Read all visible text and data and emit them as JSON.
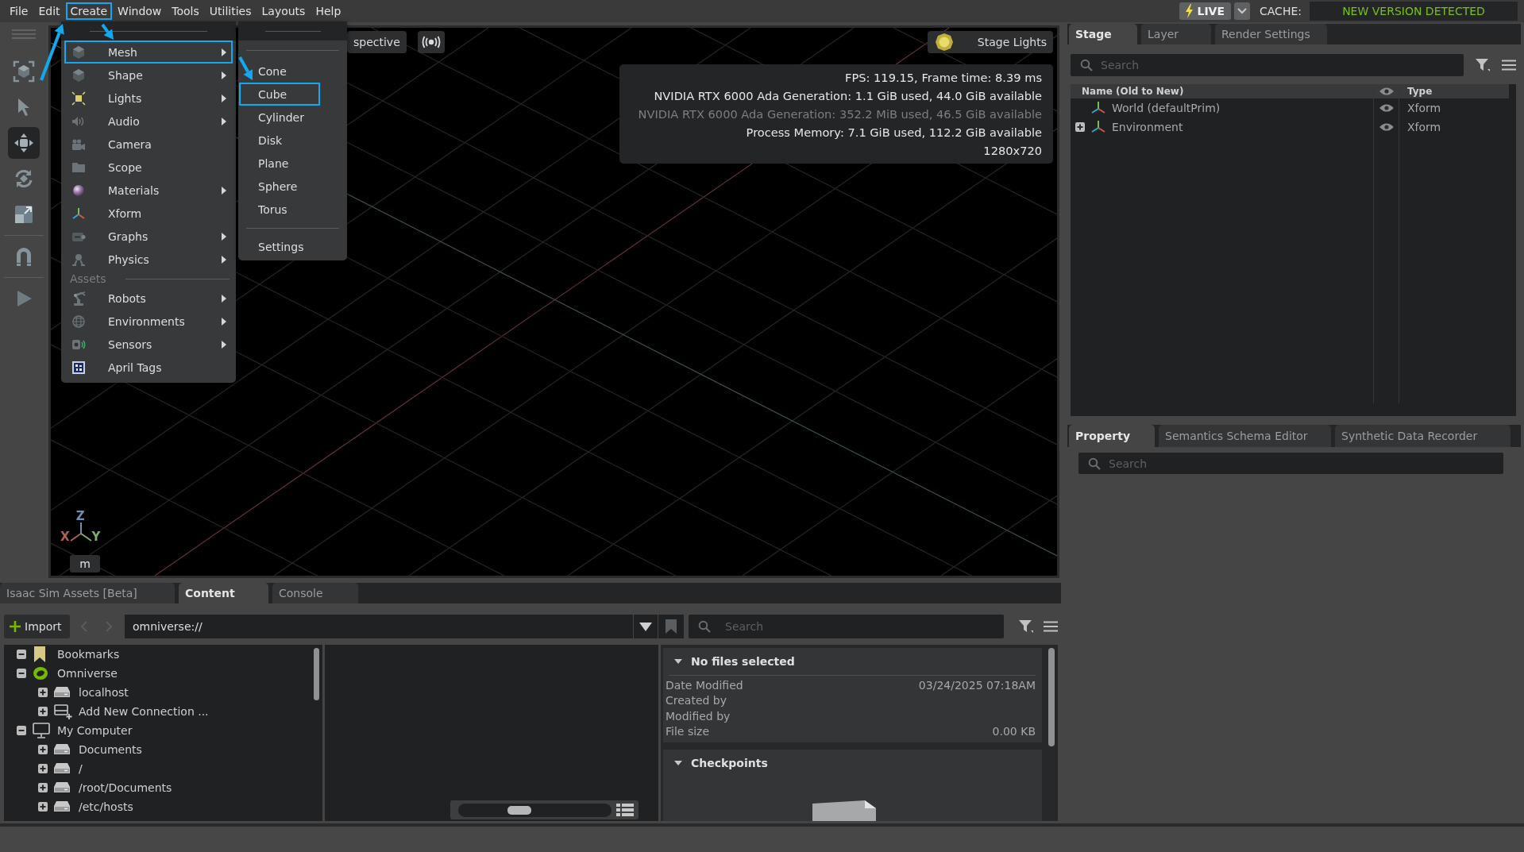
{
  "menu_bar": {
    "items": [
      {
        "label": "File",
        "highlighted": false
      },
      {
        "label": "Edit",
        "highlighted": false
      },
      {
        "label": "Create",
        "highlighted": true
      },
      {
        "label": "Window",
        "highlighted": false
      },
      {
        "label": "Tools",
        "highlighted": false
      },
      {
        "label": "Utilities",
        "highlighted": false
      },
      {
        "label": "Layouts",
        "highlighted": false
      },
      {
        "label": "Help",
        "highlighted": false
      }
    ],
    "live_button": {
      "label": "LIVE"
    },
    "cache_label": "CACHE:",
    "cache_status": "NEW VERSION DETECTED"
  },
  "create_menu": {
    "items": [
      {
        "kind": "item",
        "label": "Mesh",
        "submenu": true,
        "highlighted": true
      },
      {
        "kind": "item",
        "label": "Shape",
        "submenu": true,
        "highlighted": false
      },
      {
        "kind": "item",
        "label": "Lights",
        "submenu": true,
        "highlighted": false
      },
      {
        "kind": "item",
        "label": "Audio",
        "submenu": true,
        "highlighted": false
      },
      {
        "kind": "item",
        "label": "Camera",
        "submenu": false,
        "highlighted": false
      },
      {
        "kind": "item",
        "label": "Scope",
        "submenu": false,
        "highlighted": false
      },
      {
        "kind": "item",
        "label": "Materials",
        "submenu": true,
        "highlighted": false
      },
      {
        "kind": "item",
        "label": "Xform",
        "submenu": false,
        "highlighted": false
      },
      {
        "kind": "item",
        "label": "Graphs",
        "submenu": true,
        "highlighted": false
      },
      {
        "kind": "item",
        "label": "Physics",
        "submenu": true,
        "highlighted": false
      },
      {
        "kind": "section",
        "label": "Assets"
      },
      {
        "kind": "item",
        "label": "Robots",
        "submenu": true,
        "highlighted": false
      },
      {
        "kind": "item",
        "label": "Environments",
        "submenu": true,
        "highlighted": false
      },
      {
        "kind": "item",
        "label": "Sensors",
        "submenu": true,
        "highlighted": false
      },
      {
        "kind": "item",
        "label": "April Tags",
        "submenu": false,
        "highlighted": false
      }
    ]
  },
  "mesh_submenu": {
    "items": [
      {
        "kind": "separator"
      },
      {
        "kind": "item",
        "label": "Cone",
        "highlighted": false
      },
      {
        "kind": "item",
        "label": "Cube",
        "highlighted": true
      },
      {
        "kind": "item",
        "label": "Cylinder",
        "highlighted": false
      },
      {
        "kind": "item",
        "label": "Disk",
        "highlighted": false
      },
      {
        "kind": "item",
        "label": "Plane",
        "highlighted": false
      },
      {
        "kind": "item",
        "label": "Sphere",
        "highlighted": false
      },
      {
        "kind": "item",
        "label": "Torus",
        "highlighted": false
      },
      {
        "kind": "separator"
      },
      {
        "kind": "item",
        "label": "Settings",
        "highlighted": false
      }
    ]
  },
  "toolbar": {
    "groups": [
      {
        "tools": [
          {
            "selected": false
          },
          {
            "selected": false
          },
          {
            "selected": true
          },
          {
            "selected": false
          },
          {
            "selected": false
          }
        ]
      },
      {
        "tools": [
          {
            "selected": false
          }
        ]
      },
      {
        "tools": [
          {
            "selected": false
          }
        ]
      }
    ]
  },
  "viewport": {
    "camera_button": {
      "label": "spective"
    },
    "stage_lights_button": {
      "label": "Stage Lights"
    },
    "stats": [
      {
        "text": "FPS: 119.15, Frame time: 8.39 ms",
        "dimmed": false
      },
      {
        "text": "NVIDIA RTX 6000 Ada Generation: 1.1 GiB used, 44.0 GiB available",
        "dimmed": false
      },
      {
        "text": "NVIDIA RTX 6000 Ada Generation: 352.2 MiB used, 46.5 GiB available",
        "dimmed": true
      },
      {
        "text": "Process Memory: 7.1 GiB used, 112.2 GiB available",
        "dimmed": false
      },
      {
        "text": "1280x720",
        "dimmed": false
      }
    ],
    "axes": [
      {
        "label": "Z",
        "color": "#6f8fb0"
      },
      {
        "label": "X",
        "color": "#b0605c"
      },
      {
        "label": "Y",
        "color": "#7fae6c"
      }
    ],
    "units_button": {
      "label": "m"
    }
  },
  "stage_panel": {
    "tabs": [
      {
        "label": "Stage",
        "selected": true
      },
      {
        "label": "Layer",
        "selected": false
      },
      {
        "label": "Render Settings",
        "selected": false
      }
    ],
    "search": {
      "placeholder": "Search"
    },
    "name_column": "Name (Old to New)",
    "type_column": "Type",
    "rows": [
      {
        "kind": "leaf",
        "name": "World (defaultPrim)",
        "type": "Xform",
        "visible": true
      },
      {
        "kind": "branch",
        "name": "Environment",
        "type": "Xform",
        "visible": true,
        "expanded": false
      }
    ]
  },
  "property_panel": {
    "tabs": [
      {
        "label": "Property",
        "selected": true
      },
      {
        "label": "Semantics Schema Editor",
        "selected": false
      },
      {
        "label": "Synthetic Data Recorder",
        "selected": false
      }
    ],
    "search": {
      "placeholder": "Search"
    }
  },
  "content_panel": {
    "tabs": [
      {
        "label": "Isaac Sim Assets [Beta]",
        "selected": false
      },
      {
        "label": "Content",
        "selected": true
      },
      {
        "label": "Console",
        "selected": false
      }
    ],
    "import_button": {
      "label": "Import"
    },
    "back_button": {
      "disabled": true
    },
    "forward_button": {
      "disabled": true
    },
    "path_field": {
      "value": "omniverse://"
    },
    "search": {
      "placeholder": "Search"
    },
    "tree": [
      {
        "kind": "bookmarks",
        "label": "Bookmarks",
        "expanded": true
      },
      {
        "kind": "omniverse",
        "label": "Omniverse",
        "expanded": true,
        "children": [
          {
            "kind": "server",
            "label": "localhost",
            "expanded": false
          },
          {
            "kind": "add-connection",
            "label": "Add New Connection ...",
            "expanded": false
          }
        ]
      },
      {
        "kind": "computer",
        "label": "My Computer",
        "expanded": true,
        "children": [
          {
            "kind": "drive",
            "label": "Documents",
            "expanded": false
          },
          {
            "kind": "drive",
            "label": "/",
            "expanded": false
          },
          {
            "kind": "drive",
            "label": "/root/Documents",
            "expanded": false
          },
          {
            "kind": "drive",
            "label": "/etc/hosts",
            "expanded": false
          }
        ]
      }
    ],
    "thumbnail_slider": {
      "level": 0.4
    },
    "details": {
      "title": "No files selected",
      "expanded": true,
      "fields": [
        {
          "label": "Date Modified",
          "value": "03/24/2025 07:18AM"
        },
        {
          "label": "Created by"
        },
        {
          "label": "Modified by"
        },
        {
          "label": "File size",
          "value": "0.00 KB"
        }
      ]
    },
    "checkpoints": {
      "title": "Checkpoints",
      "expanded": true
    }
  }
}
